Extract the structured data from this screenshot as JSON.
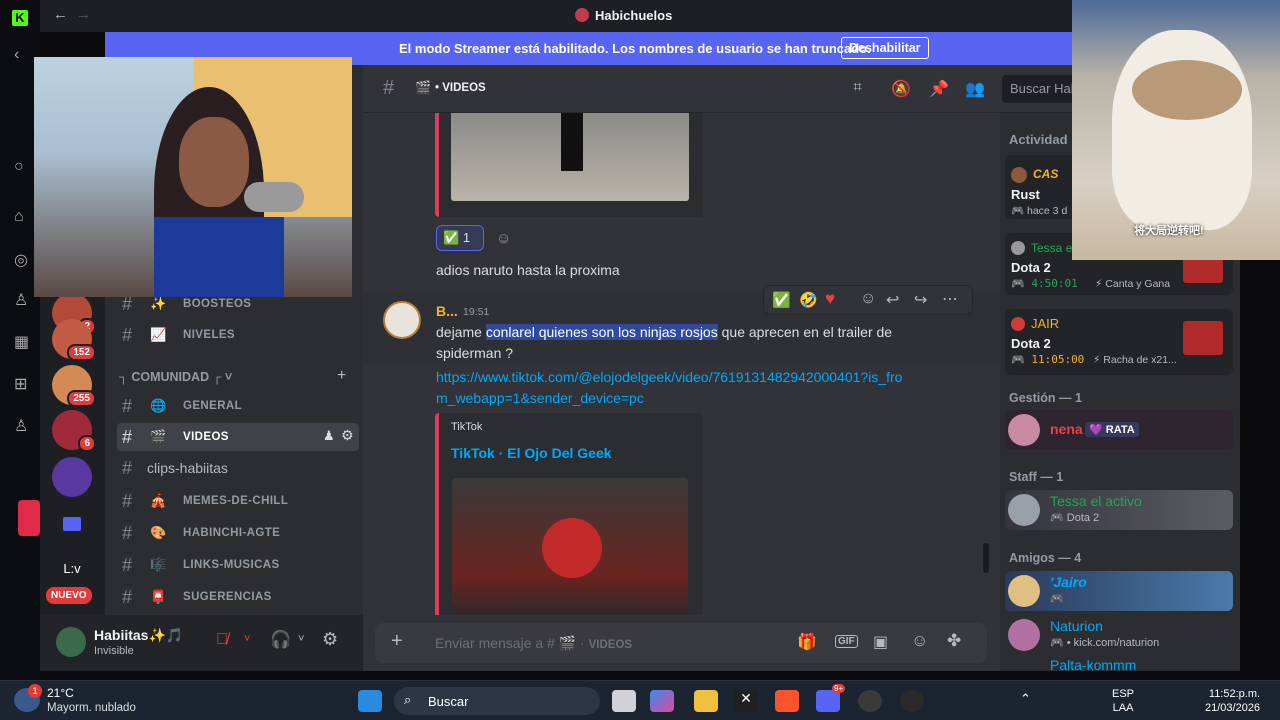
{
  "window": {
    "title": "Habichuelos",
    "back": "←",
    "forward": "→"
  },
  "banner": {
    "text": "El modo Streamer está habilitado. Los nombres de usuario se han truncado.",
    "button": "Deshabilitar"
  },
  "guilds": {
    "badges": [
      "2",
      "152",
      "255",
      "6"
    ],
    "nuevo": "NUEVO",
    "lv": "L:v"
  },
  "channels": {
    "category": "COMUNIDAD",
    "items": [
      {
        "emoji": "✨",
        "name": "BOOSTEOS"
      },
      {
        "emoji": "📈",
        "name": "NIVELES"
      },
      {
        "emoji": "🌐",
        "name": "GENERAL"
      },
      {
        "emoji": "🎬",
        "name": "VIDEOS"
      },
      {
        "emoji": "",
        "name": "clips-habiitas"
      },
      {
        "emoji": "🎪",
        "name": "MEMES-DE-CHILL"
      },
      {
        "emoji": "🎨",
        "name": "HABINCHI-AGTE"
      },
      {
        "emoji": "🎼",
        "name": "LINKS-MUSICAS"
      },
      {
        "emoji": "📮",
        "name": "SUGERENCIAS"
      }
    ]
  },
  "user": {
    "name": "Habiitas✨🎵",
    "status": "Invisible"
  },
  "header": {
    "channel": "VIDEOS",
    "emoji": "🎬",
    "search": "Buscar Hab"
  },
  "chat": {
    "reaction_count": "1",
    "msg1": "adios naruto hasta la proxima",
    "author": "B...",
    "time": "19:51",
    "msg2_pre": "dejame ",
    "msg2_sel": "conlarel quienes son los ninjas rosjos",
    "msg2_post": " que aprecen en el trailer de spiderman ?",
    "link": "https://www.tiktok.com/@elojodelgeek/video/7619131482942000401?is_from_webapp=1&sender_device=pc",
    "embed_provider": "TikTok",
    "embed_title": "TikTok · El Ojo Del Geek"
  },
  "composer": {
    "placeholder": "Enviar mensaje a #",
    "channel": "VIDEOS"
  },
  "members": {
    "activity_title": "Actividad",
    "act1": {
      "name": "CAS",
      "game": "Rust",
      "time": "hace 3 d"
    },
    "act2": {
      "name": "Tessa e",
      "game": "Dota 2",
      "time": "4:50:01",
      "extra": "Canta y Gana"
    },
    "act3": {
      "name": "JAIR",
      "game": "Dota 2",
      "time": "11:05:00",
      "extra": "Racha de x21..."
    },
    "sections": [
      {
        "title": "Gestión — 1"
      },
      {
        "title": "Staff — 1"
      },
      {
        "title": "Amigos — 4"
      }
    ],
    "m_gestion": {
      "name": "nena",
      "tag": "RATA"
    },
    "m_staff": {
      "name": "Tessa el activo",
      "sub": "Dota 2"
    },
    "m_amigos": [
      {
        "name": "'Jairo",
        "sub": ""
      },
      {
        "name": "Naturion",
        "sub": "kick.com/naturion"
      },
      {
        "name": "Palta-kommm",
        "sub": ""
      }
    ]
  },
  "cam2": {
    "caption": "将大局逆转吧!"
  },
  "taskbar": {
    "temp": "21°C",
    "weather": "Mayorm. nublado",
    "search": "Buscar",
    "lang1": "ESP",
    "lang2": "LAA",
    "time": "11:52:p.m.",
    "date": "21/03/2026",
    "notif": "1",
    "discord_badge": "9+"
  },
  "colors": {
    "blurple": "#5865f2",
    "link": "#00a8fc",
    "green": "#23a55a",
    "red": "#f23f43"
  }
}
